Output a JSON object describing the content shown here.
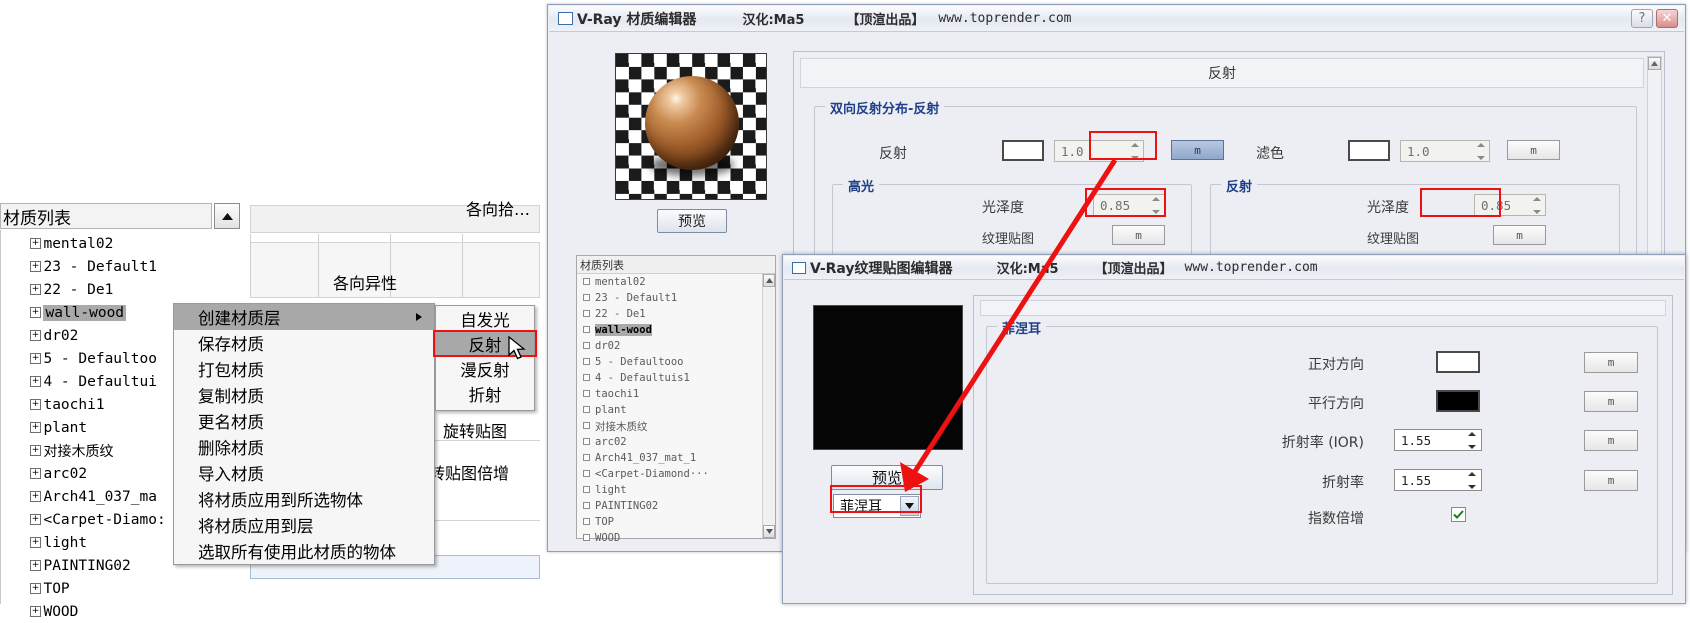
{
  "background_panel": {
    "material_list_header": "材质列表",
    "scroll_up_icon": "chevron-up-icon",
    "tree_items": [
      {
        "label": "mental02",
        "cjk": false,
        "selected": false
      },
      {
        "label": "23 - Default1",
        "cjk": false,
        "selected": false
      },
      {
        "label": "22 - De1",
        "cjk": false,
        "selected": false
      },
      {
        "label": "wall-wood",
        "cjk": false,
        "selected": true
      },
      {
        "label": "dr02",
        "cjk": false,
        "selected": false
      },
      {
        "label": "5 - Defaultoo",
        "cjk": false,
        "selected": false
      },
      {
        "label": "4 - Defaultui",
        "cjk": false,
        "selected": false
      },
      {
        "label": "taochi1",
        "cjk": false,
        "selected": false
      },
      {
        "label": "plant",
        "cjk": false,
        "selected": false
      },
      {
        "label": "对接木质纹",
        "cjk": true,
        "selected": false
      },
      {
        "label": "arc02",
        "cjk": false,
        "selected": false
      },
      {
        "label": "Arch41_037_ma",
        "cjk": false,
        "selected": false
      },
      {
        "label": "<Carpet-Diamo:",
        "cjk": false,
        "selected": false
      },
      {
        "label": "light",
        "cjk": false,
        "selected": false
      },
      {
        "label": "PAINTING02",
        "cjk": false,
        "selected": false
      },
      {
        "label": "TOP",
        "cjk": false,
        "selected": false
      },
      {
        "label": "WOOD",
        "cjk": false,
        "selected": false
      }
    ],
    "labels": {
      "anisotropy_group": "各向异性",
      "anisotropy_row": "各向异性",
      "rotate_map": "旋转贴图",
      "rotate_map_mult": "旋转贴图倍增"
    }
  },
  "context_menu": {
    "items": [
      {
        "label": "创建材质层",
        "highlighted": true,
        "submenu": true
      },
      {
        "label": "保存材质",
        "highlighted": false,
        "submenu": false
      },
      {
        "label": "打包材质",
        "highlighted": false,
        "submenu": false
      },
      {
        "label": "复制材质",
        "highlighted": false,
        "submenu": false
      },
      {
        "label": "更名材质",
        "highlighted": false,
        "submenu": false
      },
      {
        "label": "删除材质",
        "highlighted": false,
        "submenu": false
      },
      {
        "label": "导入材质",
        "highlighted": false,
        "submenu": false
      },
      {
        "label": "将材质应用到所选物体",
        "highlighted": false,
        "submenu": false
      },
      {
        "label": "将材质应用到层",
        "highlighted": false,
        "submenu": false
      },
      {
        "label": "选取所有使用此材质的物体",
        "highlighted": false,
        "submenu": false
      }
    ]
  },
  "submenu": {
    "items": [
      {
        "label": "自发光",
        "highlighted": false
      },
      {
        "label": "反射",
        "highlighted": true
      },
      {
        "label": "漫反射",
        "highlighted": false
      },
      {
        "label": "折射",
        "highlighted": false
      }
    ],
    "highlight_color": "#ee1111",
    "cursor_icon": "mouse-cursor-icon"
  },
  "window1": {
    "title_cjk": "V-Ray 材质编辑器",
    "title_credit_cjk": "汉化:Ma5",
    "title_brand_cjk": "【顶渲出品】",
    "title_url": "www.toprender.com",
    "help_button": "?",
    "close_button": "✕",
    "preview_button": "预览",
    "material_list_header": "材质列表",
    "material_list": [
      {
        "label": "mental02",
        "cjk": false,
        "selected": false
      },
      {
        "label": "23 - Default1",
        "cjk": false,
        "selected": false
      },
      {
        "label": "22 - De1",
        "cjk": false,
        "selected": false
      },
      {
        "label": "wall-wood",
        "cjk": false,
        "selected": true
      },
      {
        "label": "dr02",
        "cjk": false,
        "selected": false
      },
      {
        "label": "5 - Defaultooo",
        "cjk": false,
        "selected": false
      },
      {
        "label": "4 - Defaultuis1",
        "cjk": false,
        "selected": false
      },
      {
        "label": "taochi1",
        "cjk": false,
        "selected": false
      },
      {
        "label": "plant",
        "cjk": false,
        "selected": false
      },
      {
        "label": "对接木质纹",
        "cjk": true,
        "selected": false
      },
      {
        "label": "arc02",
        "cjk": false,
        "selected": false
      },
      {
        "label": "Arch41_037_mat_1",
        "cjk": false,
        "selected": false
      },
      {
        "label": "<Carpet-Diamond···",
        "cjk": false,
        "selected": false
      },
      {
        "label": "light",
        "cjk": false,
        "selected": false
      },
      {
        "label": "PAINTING02",
        "cjk": false,
        "selected": false
      },
      {
        "label": "TOP",
        "cjk": false,
        "selected": false
      },
      {
        "label": "WOOD",
        "cjk": false,
        "selected": false
      }
    ],
    "rollout_title": "反射",
    "brdf_group": "双向反射分布-反射",
    "reflect_label": "反射",
    "reflect_value": "1.0",
    "reflect_map_button": "m",
    "filter_label": "滤色",
    "filter_value": "1.0",
    "filter_map_button": "m",
    "highlight_group": "高光",
    "reflect_group": "反射",
    "glossiness_label": "光泽度",
    "highlight_glossiness_value": "0.85",
    "reflect_glossiness_value": "0.85",
    "texture_label": "纹理贴图",
    "texture_map_button": "m"
  },
  "window2": {
    "title_cjk": "V-Ray纹理贴图编辑器",
    "title_credit_cjk": "汉化:Ma5",
    "title_brand_cjk": "【顶渲出品】",
    "title_url": "www.toprender.com",
    "preview_button": "预览",
    "map_type": "菲涅耳",
    "dropdown_icon": "chevron-down-icon",
    "group_title": "菲涅耳",
    "rows": [
      {
        "label": "正对方向",
        "type": "swatch",
        "color": "#ffffff",
        "map_button": "m"
      },
      {
        "label": "平行方向",
        "type": "swatch",
        "color": "#000000",
        "map_button": "m"
      },
      {
        "label": "折射率 (IOR)",
        "type": "spinner",
        "value": "1.55",
        "map_button": "m"
      },
      {
        "label": "折射率",
        "type": "spinner",
        "value": "1.55",
        "map_button": "m"
      },
      {
        "label": "指数倍增",
        "type": "checkbox",
        "checked": true,
        "map_button": ""
      }
    ]
  },
  "annotation": {
    "arrow_color": "#ee1111",
    "box_color": "#ee1111"
  }
}
